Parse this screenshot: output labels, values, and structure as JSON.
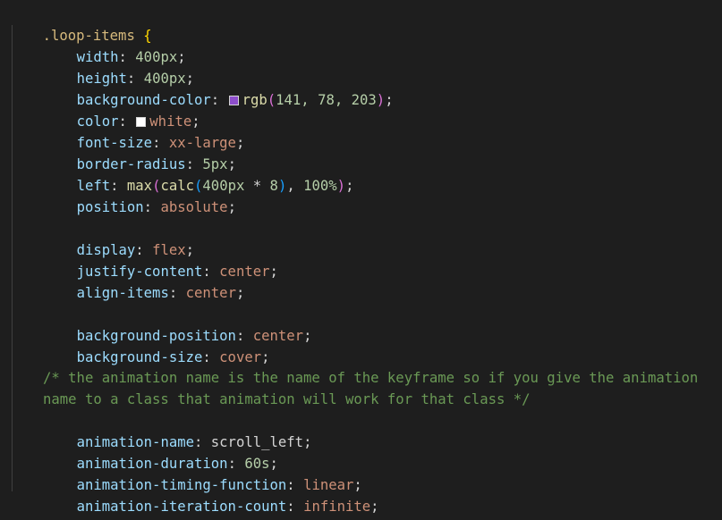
{
  "editor": {
    "selector": ".loop-items",
    "open_brace": "{",
    "close_brace": "}",
    "lines": {
      "width": {
        "prop": "width",
        "value": "400px"
      },
      "height": {
        "prop": "height",
        "value": "400px"
      },
      "bgcolor": {
        "prop": "background-color",
        "fn": "rgb",
        "args": "141, 78, 203",
        "swatch": "#8d4ecb"
      },
      "color": {
        "prop": "color",
        "value": "white",
        "swatch": "#ffffff"
      },
      "fontsize": {
        "prop": "font-size",
        "value": "xx-large"
      },
      "radius": {
        "prop": "border-radius",
        "value": "5px"
      },
      "left": {
        "prop": "left",
        "fn_max": "max",
        "fn_calc": "calc",
        "arg1": "400px",
        "op": "*",
        "arg2": "8",
        "arg3": "100%"
      },
      "position": {
        "prop": "position",
        "value": "absolute"
      },
      "display": {
        "prop": "display",
        "value": "flex"
      },
      "justify": {
        "prop": "justify-content",
        "value": "center"
      },
      "align": {
        "prop": "align-items",
        "value": "center"
      },
      "bgpos": {
        "prop": "background-position",
        "value": "center"
      },
      "bgsize": {
        "prop": "background-size",
        "value": "cover"
      },
      "comment1": "/* the animation name is the name of the keyframe so if you give the animation",
      "comment2": "name to a class that animation will work for that class */",
      "animname": {
        "prop": "animation-name",
        "value": "scroll_left"
      },
      "animdur": {
        "prop": "animation-duration",
        "value": "60s"
      },
      "animtf": {
        "prop": "animation-timing-function",
        "value": "linear"
      },
      "animiter": {
        "prop": "animation-iteration-count",
        "value": "infinite"
      }
    }
  }
}
